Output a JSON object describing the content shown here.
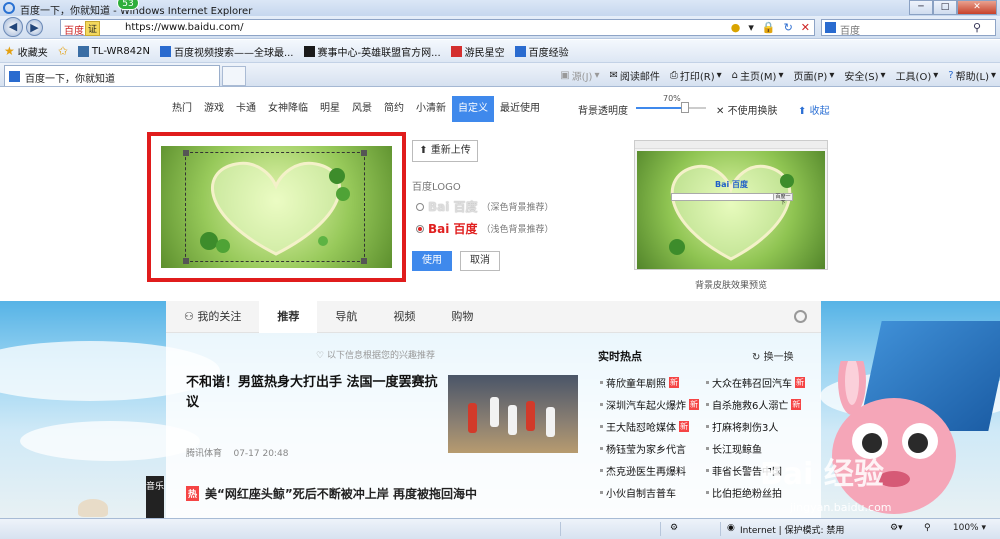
{
  "window": {
    "title": "百度一下，你就知道 - Windows Internet Explorer",
    "badge": "53",
    "buttons": [
      "─",
      "□",
      "✕"
    ]
  },
  "address": {
    "site_label": "百度",
    "site_value": "证",
    "url": "https://www.baidu.com/",
    "search_placeholder": "百度"
  },
  "favorites": {
    "label": "收藏夹",
    "items": [
      {
        "label": "TL-WR842N",
        "color": "#3a6ea5"
      },
      {
        "label": "百度视频搜索——全球最...",
        "color": "#2a6bcf"
      },
      {
        "label": "赛事中心-英雄联盟官方网...",
        "color": "#1a1a1a"
      },
      {
        "label": "游民星空",
        "color": "#d32f2f"
      },
      {
        "label": "百度经验",
        "color": "#2a6bcf"
      }
    ]
  },
  "tab": {
    "label": "百度一下，你就知道"
  },
  "commandbar": [
    {
      "label": "源(J)",
      "dim": true
    },
    {
      "label": "阅读邮件",
      "dim": false
    },
    {
      "label": "打印(R)",
      "dim": false
    },
    {
      "label": "主页(M)",
      "dim": false
    },
    {
      "label": "页面(P)",
      "dim": false
    },
    {
      "label": "安全(S)",
      "dim": false
    },
    {
      "label": "工具(O)",
      "dim": false
    },
    {
      "label": "帮助(L)",
      "dim": false
    }
  ],
  "skin": {
    "tabs": [
      "热门",
      "游戏",
      "卡通",
      "女神降临",
      "明星",
      "风景",
      "简约",
      "小清新",
      "自定义",
      "最近使用"
    ],
    "active_tab": "自定义",
    "opacity_label": "背景透明度",
    "opacity_value": "70%",
    "opacity_fraction": 0.7,
    "no_change": "不使用换肤",
    "collapse": "收起",
    "reupload": "重新上传",
    "logo_title": "百度LOGO",
    "logo_options": [
      {
        "logo": "Bai 百度",
        "hint": "（深色背景推荐）",
        "selected": false
      },
      {
        "logo": "Bai 百度",
        "hint": "（浅色背景推荐）",
        "selected": true
      }
    ],
    "apply": "使用",
    "cancel": "取消",
    "preview_caption": "背景皮肤效果预览",
    "preview_logo": "Bai 百度",
    "preview_button": "百度一下"
  },
  "feed": {
    "tabs": [
      "我的关注",
      "推荐",
      "导航",
      "视频",
      "购物"
    ],
    "active_tab": "推荐",
    "interest_note": "以下信息根据您的兴趣推荐",
    "headline": "不和谐！男篮热身大打出手 法国一度罢赛抗议",
    "source": "腾讯体育",
    "time": "07-17 20:48",
    "hot_title": "实时热点",
    "hot_refresh": "换一换",
    "hot_left": [
      {
        "text": "蒋欣童年剧照",
        "new": true
      },
      {
        "text": "深圳汽车起火爆炸",
        "new": true
      },
      {
        "text": "王大陆怼呛媒体",
        "new": true
      },
      {
        "text": "杨钰莹为家乡代言",
        "new": false
      },
      {
        "text": "杰克逊医生再爆料",
        "new": false
      },
      {
        "text": "小伙自制吉普车",
        "new": false
      }
    ],
    "hot_right": [
      {
        "text": "大众在韩召回汽车",
        "new": true
      },
      {
        "text": "自杀施救6人溺亡",
        "new": true
      },
      {
        "text": "打麻将刺伤3人",
        "new": false
      },
      {
        "text": "长江现鲸鱼",
        "new": false
      },
      {
        "text": "菲省长警告中国",
        "new": false
      },
      {
        "text": "比伯拒绝粉丝拍",
        "new": false
      }
    ],
    "bottom_tag": "热",
    "bottom_headline": "美“网红座头鲸”死后不断被冲上岸 再度被拖回海中",
    "music": "音乐"
  },
  "watermark": {
    "text": "Bai 经验",
    "url": "jingyan.baidu.com"
  },
  "status": {
    "zone": "Internet | 保护模式: 禁用",
    "zoom": "100%"
  }
}
